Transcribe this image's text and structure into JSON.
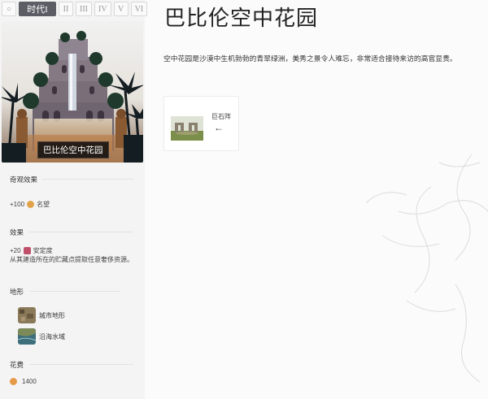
{
  "era_tabs": [
    {
      "label": "○",
      "active": false
    },
    {
      "label": "时代I",
      "active": true
    },
    {
      "label": "II",
      "active": false
    },
    {
      "label": "III",
      "active": false
    },
    {
      "label": "IV",
      "active": false
    },
    {
      "label": "V",
      "active": false
    },
    {
      "label": "VI",
      "active": false
    }
  ],
  "wonder": {
    "name": "巴比伦空中花园",
    "description": "空中花园是沙漠中生机勃勃的青翠绿洲，美秀之景令人难忘，非常适合接待来访的高官显贵。"
  },
  "sections": {
    "wonder_effect": {
      "title": "奇观效果",
      "amount": "+100",
      "resource": "名望"
    },
    "effect": {
      "title": "效果",
      "amount": "+20",
      "resource": "安定度",
      "detail": "从其建造所在的贮藏点提取任意奢侈资源。"
    },
    "terrain": {
      "title": "地形",
      "items": [
        "城市地形",
        "沿海水域"
      ]
    },
    "cost": {
      "title": "花费",
      "amount": "1400"
    }
  },
  "related": {
    "name": "巨石阵",
    "arrow": "←"
  },
  "colors": {
    "active_tab": "#5d5d66",
    "resource_coin": "#e2a24a",
    "stability_icon": "#c0506a"
  }
}
